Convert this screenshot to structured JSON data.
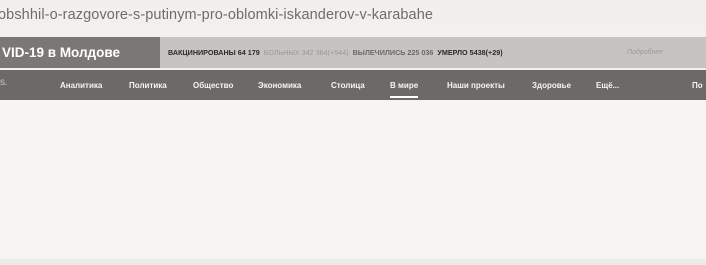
{
  "browser": {
    "url_fragment": "obshhil-o-razgovore-s-putinym-pro-oblomki-iskanderov-v-karabahe"
  },
  "covid_bar": {
    "title": "VID-19 в Молдове",
    "vaccinated": "ВАКЦИНИРОВАНЫ 64 179",
    "sick": "БОЛЬНЫХ 342 364(+544)",
    "recovered": "ВЫЛЕЧИЛИСЬ 225 036",
    "deaths": "УМЕРЛО 5438(+29)",
    "more_link": "Подробнее"
  },
  "nav": {
    "logo_fragment": "s.",
    "items": [
      {
        "label": "Аналитика"
      },
      {
        "label": "Политика"
      },
      {
        "label": "Общество"
      },
      {
        "label": "Экономика"
      },
      {
        "label": "Столица"
      },
      {
        "label": "В мире",
        "active": true
      },
      {
        "label": "Наши проекты"
      },
      {
        "label": "Здоровье"
      },
      {
        "label": "Ещё..."
      },
      {
        "label": "По"
      }
    ]
  },
  "colors": {
    "covid_title_bg": "#7b7774",
    "covid_bar_bg": "#c7c3c0",
    "nav_bg": "#6d6966",
    "page_bg": "#f6f5f3"
  }
}
